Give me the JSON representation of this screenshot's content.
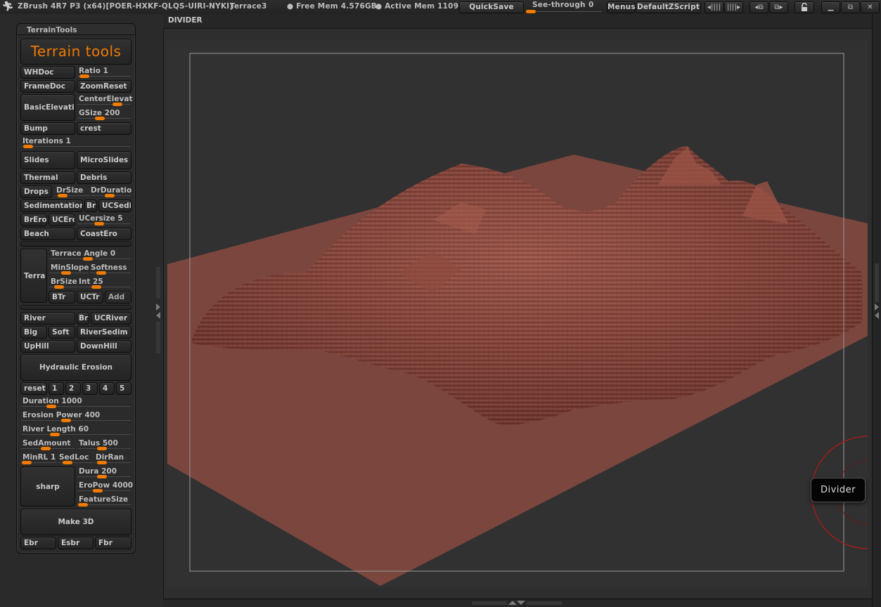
{
  "titlebar": {
    "app_title": "ZBrush 4R7 P3 (x64)[POER-HXKF-QLQS-UIRI-NYKI]",
    "document_name": "Terrace3",
    "free_mem": "● Free Mem 4.576GB",
    "active_mem": "● Active Mem 1109",
    "quicksave": "QuickSave",
    "see_through_label": "See-through",
    "see_through_value": "0",
    "see_through_fraction": 0,
    "menus": "Menus",
    "script": "DefaultZScript",
    "icons": [
      "scroll-left-icon",
      "scroll-right-icon",
      "layout-prev-icon",
      "layout-next-icon",
      "lock-icon",
      "minimize-icon",
      "restore-icon",
      "close-icon"
    ],
    "icon_glyphs": {
      "scroll_left": "◂||||",
      "scroll_right": "||||▸",
      "layout_prev": "◂⧉",
      "layout_next": "⧉▸",
      "lock": "🔓",
      "minimize": "▁",
      "restore": "⧉",
      "close": "✕"
    }
  },
  "palette": {
    "title": "TerrainTools",
    "header_button": "Terrain tools",
    "buttons": {
      "whdoc": "WHDoc",
      "framedoc": "FrameDoc",
      "zoomreset": "ZoomReset",
      "basicelevation": "BasicElevatio",
      "bump": "Bump",
      "crest": "crest",
      "slides": "Slides",
      "microslides": "MicroSlides",
      "thermal": "Thermal",
      "debris": "Debris",
      "drops": "Drops",
      "sedimentation": "Sedimentation",
      "br1": "Br",
      "ucsedi": "UCSedi",
      "brero": "BrEro",
      "ucero": "UCEro",
      "beach": "Beach",
      "coastero": "CoastEro",
      "terra": "Terra",
      "btr": "BTr",
      "uctr": "UCTr",
      "add": "Add",
      "river": "River",
      "br2": "Br",
      "ucriver": "UCRiver",
      "big": "Big",
      "soft": "Soft",
      "riversedim": "RiverSedim",
      "uphill": "UpHill",
      "downhill": "DownHill",
      "hydraulic": "Hydraulic Erosion",
      "reset": "reset",
      "preset1": "1",
      "preset2": "2",
      "preset3": "3",
      "preset4": "4",
      "preset5": "5",
      "sharp": "sharp",
      "make3d": "Make 3D",
      "ebr": "Ebr",
      "esbr": "Esbr",
      "fbr": "Fbr"
    },
    "sliders": {
      "ratio": {
        "label": "Ratio 1",
        "fraction": 0.05
      },
      "centerelevat": {
        "label": "CenterElevat",
        "fraction": 0.8
      },
      "gsize": {
        "label": "GSize 200",
        "fraction": 0.4
      },
      "iterations": {
        "label": "Iterations 1",
        "fraction": 0.02
      },
      "drsize": {
        "label": "DrSize",
        "fraction": 0.1
      },
      "drduration": {
        "label": "DrDuratio",
        "fraction": 0.45
      },
      "ucersize": {
        "label": "UCersize 5",
        "fraction": 0.38
      },
      "terrace_angle": {
        "label": "Terrace Angle 0",
        "fraction": 0.47
      },
      "minslope": {
        "label": "MinSlope",
        "fraction": 0.4
      },
      "softness": {
        "label": "Softness",
        "fraction": 0.2
      },
      "brsize": {
        "label": "BrSize",
        "fraction": 0.25
      },
      "int": {
        "label": "Int 25",
        "fraction": 0.3
      },
      "duration": {
        "label": "Duration 1000",
        "fraction": 0.25
      },
      "erosion_power": {
        "label": "Erosion Power 400",
        "fraction": 0.4
      },
      "river_length": {
        "label": "River Length 60",
        "fraction": 0.29
      },
      "sedamount": {
        "label": "SedAmount",
        "fraction": 0.45
      },
      "talus": {
        "label": "Talus 500",
        "fraction": 0.45
      },
      "minrl": {
        "label": "MinRL 1",
        "fraction": 0.02
      },
      "sedloc": {
        "label": "SedLoc",
        "fraction": 0.2
      },
      "dirran": {
        "label": "DirRan",
        "fraction": 0.1
      },
      "dura": {
        "label": "Dura 200",
        "fraction": 0.45
      },
      "eropow": {
        "label": "EroPow 4000",
        "fraction": 0.35
      },
      "featuresize": {
        "label": "FeatureSize",
        "fraction": 0.02
      }
    }
  },
  "document": {
    "header_label": "DIVIDER",
    "tooltip": "Divider"
  },
  "colors": {
    "accent": "#f07b00",
    "terrain": "#7a463e",
    "terrain_highlight": "#a55a4e",
    "canvas_bg": "#313131",
    "gizmo": "#b01818"
  }
}
